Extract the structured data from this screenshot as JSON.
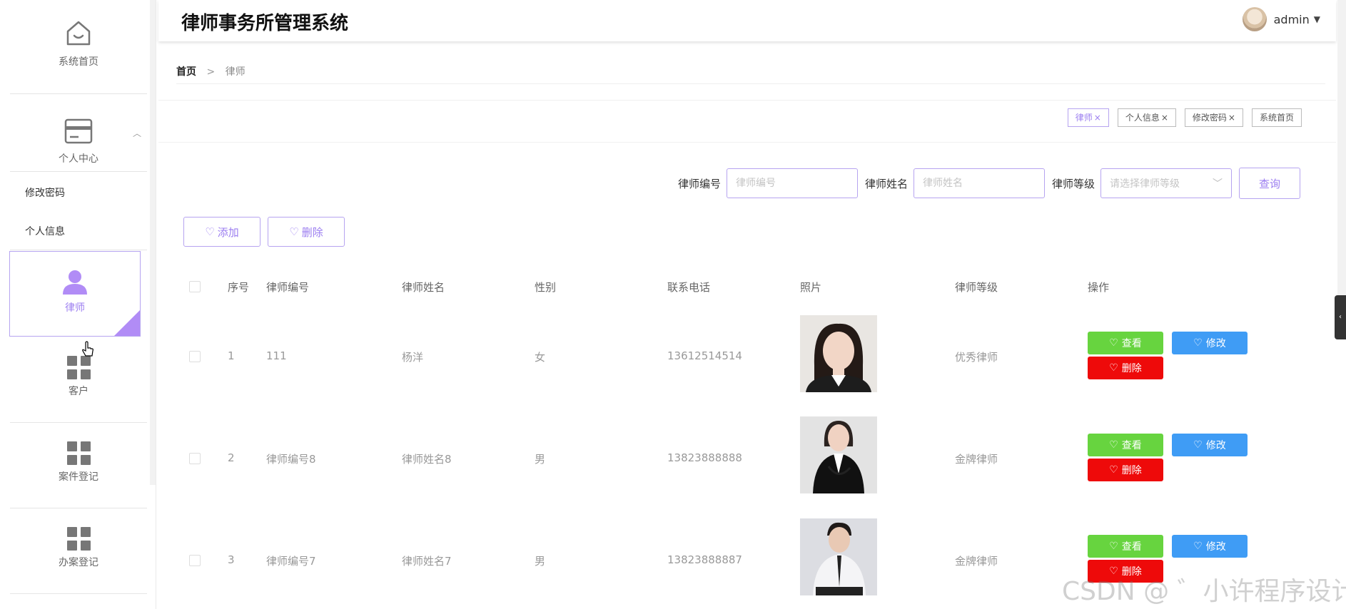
{
  "app": {
    "title": "律师事务所管理系统"
  },
  "user": {
    "name": "admin"
  },
  "sidebar": {
    "home": "系统首页",
    "personal": "个人中心",
    "sub_items": [
      "修改密码",
      "个人信息"
    ],
    "lawyer": "律师",
    "client": "客户",
    "case_reg": "案件登记",
    "handle_reg": "办案登记"
  },
  "breadcrumb": {
    "home": "首页",
    "sep": ">",
    "current": "律师"
  },
  "tags": [
    {
      "label": "律师",
      "close": "×"
    },
    {
      "label": "个人信息",
      "close": "×"
    },
    {
      "label": "修改密码",
      "close": "×"
    },
    {
      "label": "系统首页",
      "close": ""
    }
  ],
  "search": {
    "no_label": "律师编号",
    "no_placeholder": "律师编号",
    "name_label": "律师姓名",
    "name_placeholder": "律师姓名",
    "level_label": "律师等级",
    "level_placeholder": "请选择律师等级",
    "query": "查询"
  },
  "toolbar": {
    "add": "添加",
    "delete": "删除"
  },
  "table": {
    "headers": [
      "序号",
      "律师编号",
      "律师姓名",
      "性别",
      "联系电话",
      "照片",
      "律师等级",
      "操作"
    ],
    "rows": [
      {
        "idx": "1",
        "no": "111",
        "name": "杨洋",
        "gender": "女",
        "phone": "13612514514",
        "level": "优秀律师"
      },
      {
        "idx": "2",
        "no": "律师编号8",
        "name": "律师姓名8",
        "gender": "男",
        "phone": "13823888888",
        "level": "金牌律师"
      },
      {
        "idx": "3",
        "no": "律师编号7",
        "name": "律师姓名7",
        "gender": "男",
        "phone": "13823888887",
        "level": "金牌律师"
      }
    ],
    "ops": {
      "view": "查看",
      "edit": "修改",
      "delete": "删除"
    }
  },
  "watermark": "CSDN @ ゛小许程序设计",
  "colors": {
    "accent": "#9b7df0",
    "view": "#67d43f",
    "edit": "#3f9cf5",
    "delete": "#ee0a0a"
  }
}
